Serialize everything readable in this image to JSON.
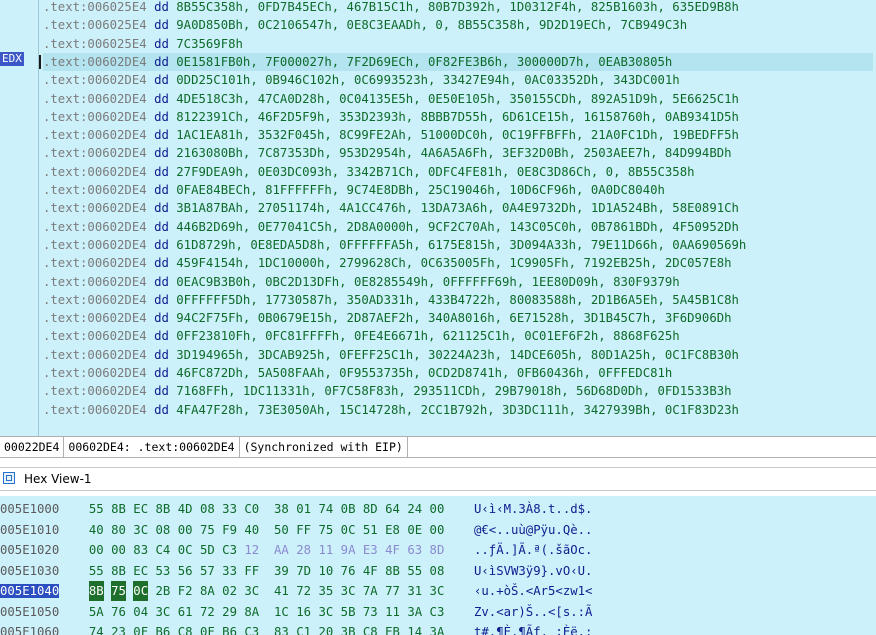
{
  "disasm": {
    "register_tag": "EDX",
    "lines": [
      {
        "addr": ".text:006025E4",
        "op": "dd",
        "operands": "8B55C358h, 0FD7B45ECh, 467B15C1h, 80B7D392h, 1D0312F4h, 825B1603h, 635ED9B8h"
      },
      {
        "addr": ".text:006025E4",
        "op": "dd",
        "operands": "9A0D850Bh, 0C2106547h, 0E8C3EAADh, 0, 8B55C358h, 9D2D19ECh, 7CB949C3h"
      },
      {
        "addr": ".text:006025E4",
        "op": "dd",
        "operands": "7C3569F8h"
      },
      {
        "addr": ".text:00602DE4",
        "op": "dd",
        "operands": "0E1581FB0h, 7F000027h, 7F2D69ECh, 0F82FE3B6h, 300000D7h, 0EAB30805h",
        "current": true
      },
      {
        "addr": ".text:00602DE4",
        "op": "dd",
        "operands": "0DD25C101h, 0B946C102h, 0C6993523h, 33427E94h, 0AC03352Dh, 343DC001h"
      },
      {
        "addr": ".text:00602DE4",
        "op": "dd",
        "operands": "4DE518C3h, 47CA0D28h, 0C04135E5h, 0E50E105h, 350155CDh, 892A51D9h, 5E6625C1h"
      },
      {
        "addr": ".text:00602DE4",
        "op": "dd",
        "operands": "8122391Ch, 46F2D5F9h, 353D2393h, 8BBB7D55h, 6D61CE15h, 16158760h, 0AB9341D5h"
      },
      {
        "addr": ".text:00602DE4",
        "op": "dd",
        "operands": "1AC1EA81h, 3532F045h, 8C99FE2Ah, 51000DC0h, 0C19FFBFFh, 21A0FC1Dh, 19BEDFF5h"
      },
      {
        "addr": ".text:00602DE4",
        "op": "dd",
        "operands": "2163080Bh, 7C87353Dh, 953D2954h, 4A6A5A6Fh, 3EF32D0Bh, 2503AEE7h, 84D994BDh"
      },
      {
        "addr": ".text:00602DE4",
        "op": "dd",
        "operands": "27F9DEA9h, 0E03DC093h, 3342B71Ch, 0DFC4FE81h, 0E8C3D86Ch, 0, 8B55C358h"
      },
      {
        "addr": ".text:00602DE4",
        "op": "dd",
        "operands": "0FAE84BECh, 81FFFFFFh, 9C74E8DBh, 25C19046h, 10D6CF96h, 0A0DC8040h"
      },
      {
        "addr": ".text:00602DE4",
        "op": "dd",
        "operands": "3B1A87BAh, 27051174h, 4A1CC476h, 13DA73A6h, 0A4E9732Dh, 1D1A524Bh, 58E0891Ch"
      },
      {
        "addr": ".text:00602DE4",
        "op": "dd",
        "operands": "446B2D69h, 0E77041C5h, 2D8A0000h, 9CF2C70Ah, 143C05C0h, 0B7861BDh, 4F50952Dh"
      },
      {
        "addr": ".text:00602DE4",
        "op": "dd",
        "operands": "61D8729h, 0E8EDA5D8h, 0FFFFFFA5h, 6175E815h, 3D094A33h, 79E11D66h, 0AA690569h"
      },
      {
        "addr": ".text:00602DE4",
        "op": "dd",
        "operands": "459F4154h, 1DC10000h, 2799628Ch, 0C635005Fh, 1C9905Fh, 7192EB25h, 2DC057E8h"
      },
      {
        "addr": ".text:00602DE4",
        "op": "dd",
        "operands": "0EAC9B3B0h, 0BC2D13DFh, 0E8285549h, 0FFFFFF69h, 1EE80D09h, 830F9379h"
      },
      {
        "addr": ".text:00602DE4",
        "op": "dd",
        "operands": "0FFFFFF5Dh, 17730587h, 350AD331h, 433B4722h, 80083588h, 2D1B6A5Eh, 5A45B1C8h"
      },
      {
        "addr": ".text:00602DE4",
        "op": "dd",
        "operands": "94C2F75Fh, 0B0679E15h, 2D87AEF2h, 340A8016h, 6E71528h, 3D1B45C7h, 3F6D906Dh"
      },
      {
        "addr": ".text:00602DE4",
        "op": "dd",
        "operands": "0FF23810Fh, 0FC81FFFFh, 0FE4E6671h, 621125C1h, 0C01EF6F2h, 8868F625h"
      },
      {
        "addr": ".text:00602DE4",
        "op": "dd",
        "operands": "3D194965h, 3DCAB925h, 0FEFF25C1h, 30224A23h, 14DCE605h, 80D1A25h, 0C1FC8B30h"
      },
      {
        "addr": ".text:00602DE4",
        "op": "dd",
        "operands": "46FC872Dh, 5A508FAAh, 0F9553735h, 0CD2D8741h, 0FB60436h, 0FFFEDC81h"
      },
      {
        "addr": ".text:00602DE4",
        "op": "dd",
        "operands": "7168FFh, 1DC11331h, 0F7C58F83h, 293511CDh, 29B79018h, 56D68D0Dh, 0FD1533B3h"
      },
      {
        "addr": ".text:00602DE4",
        "op": "dd",
        "operands": "4FA47F28h, 73E3050Ah, 15C14728h, 2CC1B792h, 3D3DC111h, 3427939Bh, 0C1F83D23h"
      }
    ]
  },
  "status": {
    "offset": "00022DE4",
    "location": "00602DE4: .text:00602DE4",
    "note": "(Synchronized with EIP)"
  },
  "hexview": {
    "title": "Hex View-1",
    "rows": [
      {
        "addr": "005E1000",
        "bytes": [
          "55",
          "8B",
          "EC",
          "8B",
          "4D",
          "08",
          "33",
          "C0",
          "38",
          "01",
          "74",
          "0B",
          "8D",
          "64",
          "24",
          "00"
        ],
        "ascii": "U‹ì‹M.3À8.t..d$."
      },
      {
        "addr": "005E1010",
        "bytes": [
          "40",
          "80",
          "3C",
          "08",
          "00",
          "75",
          "F9",
          "40",
          "50",
          "FF",
          "75",
          "0C",
          "51",
          "E8",
          "0E",
          "00"
        ],
        "ascii": "@€<..uù@Pÿu.Qè.."
      },
      {
        "addr": "005E1020",
        "bytes": [
          "00",
          "00",
          "83",
          "C4",
          "0C",
          "5D",
          "C3",
          "12",
          "AA",
          "28",
          "11",
          "9A",
          "E3",
          "4F",
          "63",
          "8D"
        ],
        "ascii": "..ƒÄ.]Ã.ª(.šãOc."
      },
      {
        "addr": "005E1030",
        "bytes": [
          "55",
          "8B",
          "EC",
          "53",
          "56",
          "57",
          "33",
          "FF",
          "39",
          "7D",
          "10",
          "76",
          "4F",
          "8B",
          "55",
          "08"
        ],
        "ascii": "U‹ìSVW3ÿ9}.vO‹U."
      },
      {
        "addr": "005E1040",
        "bytes": [
          "8B",
          "75",
          "0C",
          "2B",
          "F2",
          "8A",
          "02",
          "3C",
          "41",
          "72",
          "35",
          "3C",
          "7A",
          "77",
          "31",
          "3C"
        ],
        "ascii": "‹u.+òŠ.<Ar5<zw1<",
        "current": true
      },
      {
        "addr": "005E1050",
        "bytes": [
          "5A",
          "76",
          "04",
          "3C",
          "61",
          "72",
          "29",
          "8A",
          "1C",
          "16",
          "3C",
          "5B",
          "73",
          "11",
          "3A",
          "C3"
        ],
        "ascii": "Zv.<ar)Š..<[s.:Ã"
      },
      {
        "addr": "005E1060",
        "bytes": [
          "74",
          "23",
          "0F",
          "B6",
          "C8",
          "0F",
          "B6",
          "C3",
          "83",
          "C1",
          "20",
          "3B",
          "C8",
          "EB",
          "14",
          "3A"
        ],
        "ascii": "t#.¶È.¶Ãƒ. ;Èë.:"
      }
    ]
  }
}
